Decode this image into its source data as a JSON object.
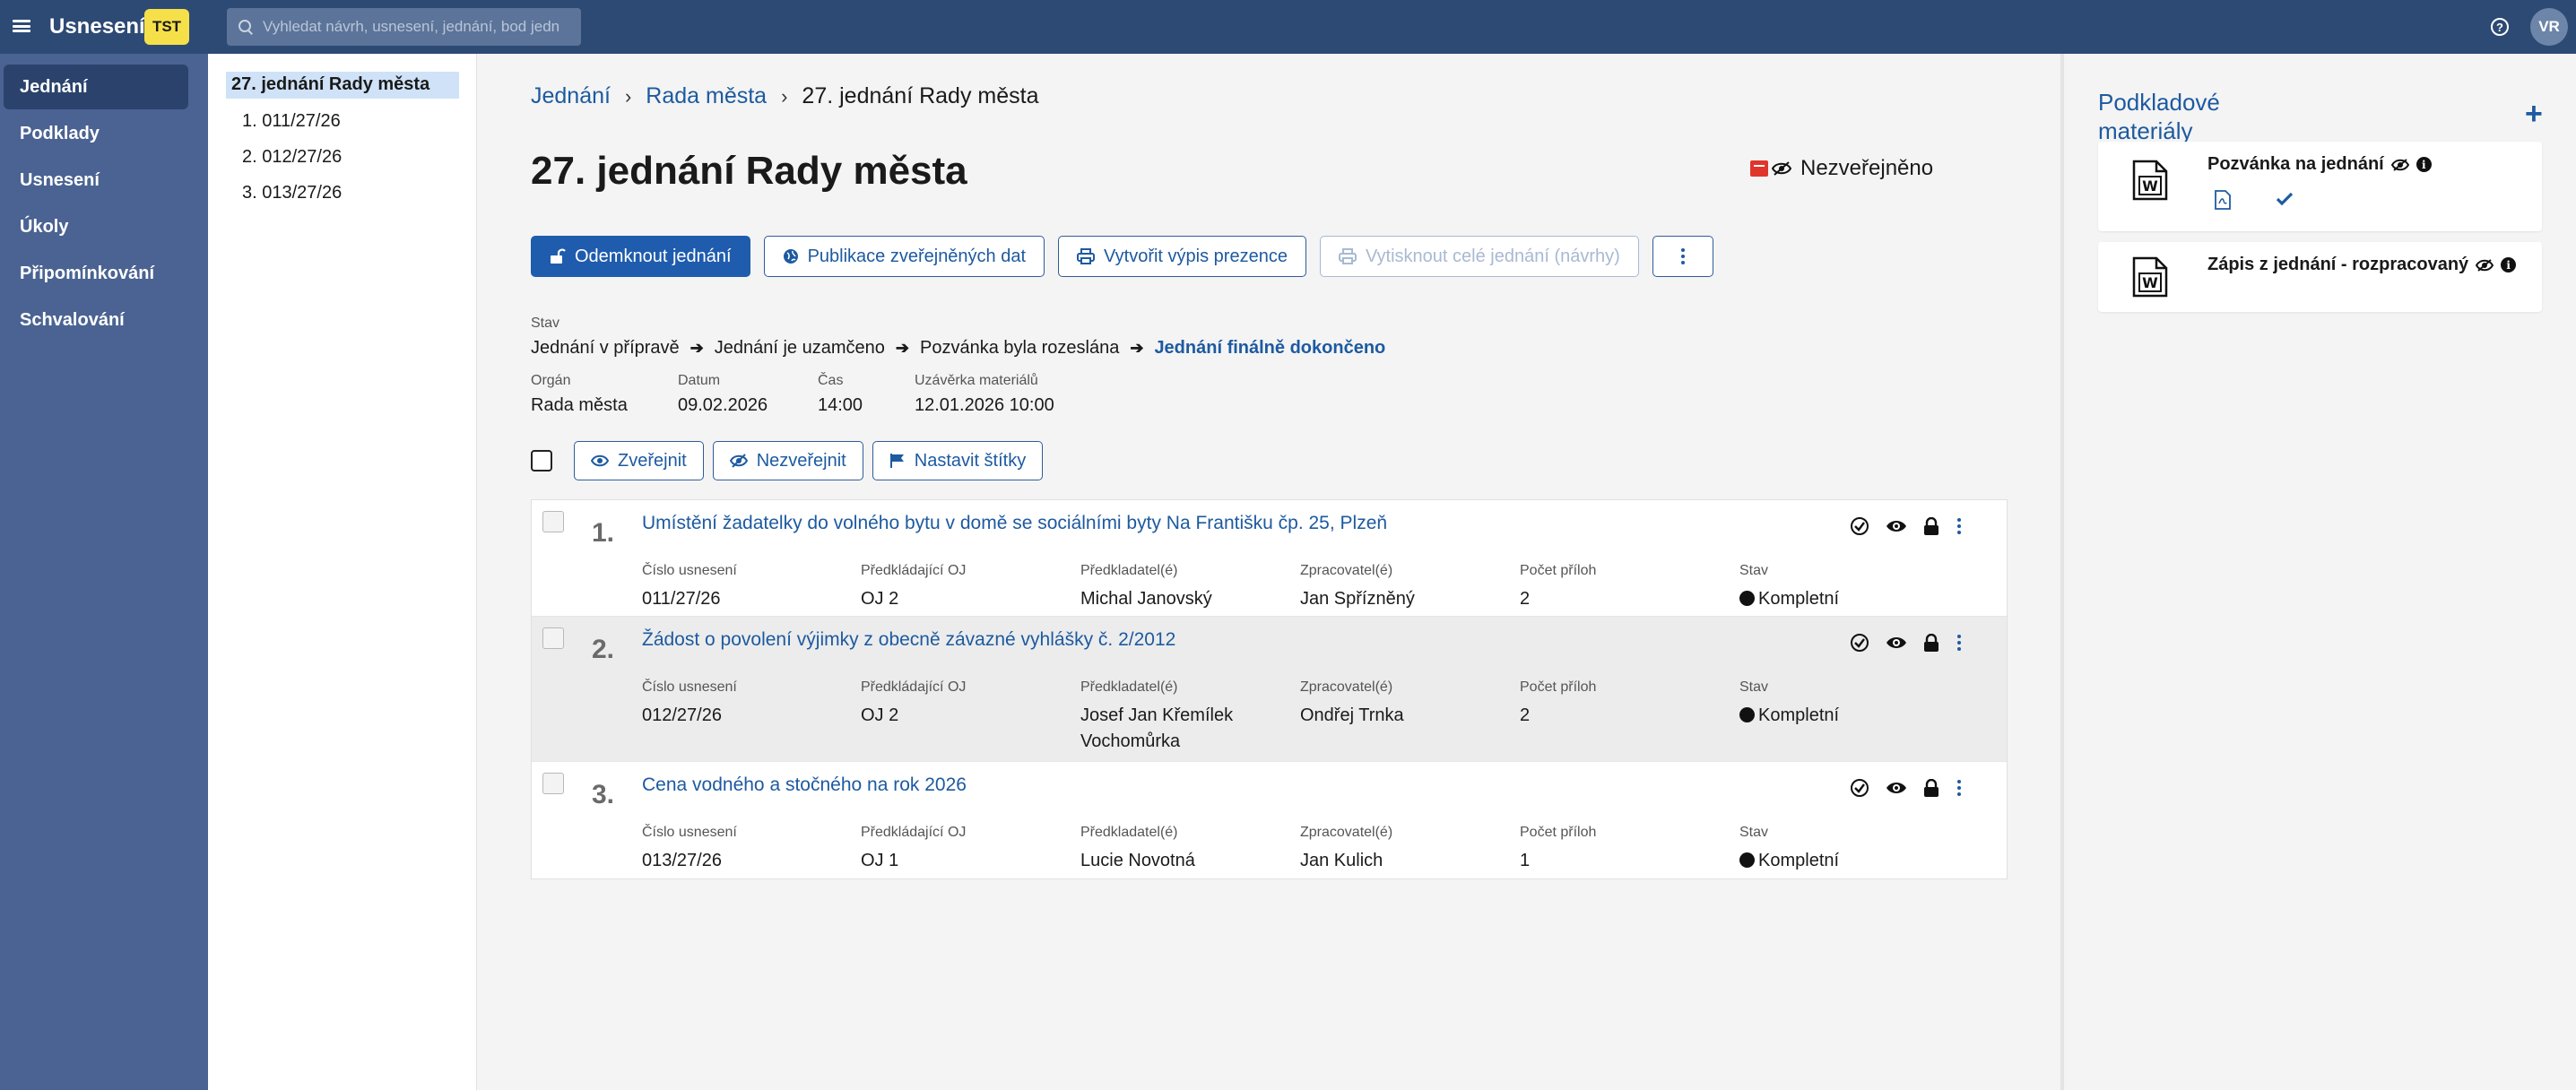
{
  "app": {
    "title": "Usnesení",
    "env_badge": "TST",
    "search_placeholder": "Vyhledat návrh, usnesení, jednání, bod jednání",
    "user_initials": "VR",
    "help_symbol": "?"
  },
  "sidebar": {
    "items": [
      {
        "label": "Jednání",
        "active": true
      },
      {
        "label": "Podklady"
      },
      {
        "label": "Usnesení"
      },
      {
        "label": "Úkoly"
      },
      {
        "label": "Připomínkování"
      },
      {
        "label": "Schvalování"
      }
    ]
  },
  "tree": {
    "root": "27. jednání Rady města",
    "items": [
      "1. 011/27/26",
      "2. 012/27/26",
      "3. 013/27/26"
    ]
  },
  "breadcrumb": {
    "items": [
      "Jednání",
      "Rada města"
    ],
    "current": "27. jednání Rady města"
  },
  "meeting": {
    "title": "27. jednání Rady města",
    "publication_status": "Nezveřejněno"
  },
  "toolbar": {
    "unlock": "Odemknout jednání",
    "publish_data": "Publikace zveřejněných dat",
    "attendance": "Vytvořit výpis prezence",
    "print_all": "Vytisknout celé jednání (návrhy)"
  },
  "status": {
    "label": "Stav",
    "steps": [
      "Jednání v přípravě",
      "Jednání je uzamčeno",
      "Pozvánka byla rozeslána"
    ],
    "final": "Jednání finálně dokončeno"
  },
  "details": {
    "organ_label": "Orgán",
    "organ": "Rada města",
    "date_label": "Datum",
    "date": "09.02.2026",
    "time_label": "Čas",
    "time": "14:00",
    "deadline_label": "Uzávěrka materiálů",
    "deadline": "12.01.2026 10:00"
  },
  "bulk": {
    "publish": "Zveřejnit",
    "unpublish": "Nezveřejnit",
    "tags": "Nastavit štítky"
  },
  "columns": {
    "number": "Číslo usnesení",
    "dept": "Předkládající OJ",
    "presenter": "Předkladatel(é)",
    "processor": "Zpracovatel(é)",
    "attachments": "Počet příloh",
    "state": "Stav"
  },
  "points": [
    {
      "num": "1.",
      "title": "Umístění žadatelky do volného bytu v domě se sociálními byty Na Františku čp. 25, Plzeň",
      "number": "011/27/26",
      "dept": "OJ 2",
      "presenter": "Michal Janovský",
      "presenter2": "",
      "processor": "Jan Spřízněný",
      "attachments": "2",
      "state": "Kompletní"
    },
    {
      "num": "2.",
      "title": "Žádost o povolení výjimky z obecně závazné vyhlášky č. 2/2012",
      "number": "012/27/26",
      "dept": "OJ 2",
      "presenter": "Josef Jan Křemílek",
      "presenter2": "Vochomůrka",
      "processor": "Ondřej Trnka",
      "attachments": "2",
      "state": "Kompletní"
    },
    {
      "num": "3.",
      "title": "Cena vodného a stočného na rok 2026",
      "number": "013/27/26",
      "dept": "OJ 1",
      "presenter": "Lucie Novotná",
      "presenter2": "",
      "processor": "Jan Kulich",
      "attachments": "1",
      "state": "Kompletní"
    }
  ],
  "materials": {
    "title": "Podkladové materiály",
    "add_symbol": "+",
    "docs": [
      {
        "name": "Pozvánka na jednání"
      },
      {
        "name": "Zápis z jednání - rozpracovaný"
      }
    ]
  },
  "colors": {
    "accent": "#1f5cae",
    "topbar": "#2d4a75",
    "sidebar": "#4a6392",
    "env_badge": "#f5e04a"
  }
}
